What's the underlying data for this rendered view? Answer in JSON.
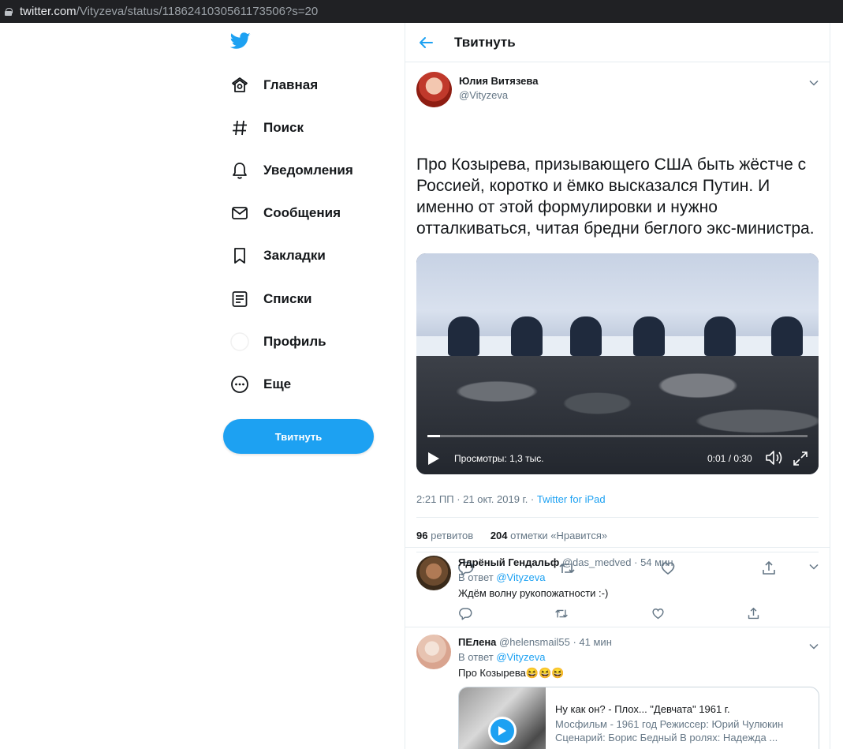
{
  "browser": {
    "url_host": "twitter.com",
    "url_path": "/Vityzeva/status/1186241030561173506?s=20"
  },
  "nav": {
    "items": [
      {
        "label": "Главная",
        "icon": "home-icon"
      },
      {
        "label": "Поиск",
        "icon": "hashtag-icon"
      },
      {
        "label": "Уведомления",
        "icon": "bell-icon"
      },
      {
        "label": "Сообщения",
        "icon": "mail-icon"
      },
      {
        "label": "Закладки",
        "icon": "bookmark-icon"
      },
      {
        "label": "Списки",
        "icon": "list-icon"
      },
      {
        "label": "Профиль",
        "icon": "profile-icon"
      },
      {
        "label": "Еще",
        "icon": "more-icon"
      }
    ],
    "tweet_button": "Твитнуть"
  },
  "header": {
    "title": "Твитнуть"
  },
  "tweet": {
    "author_name": "Юлия Витязева",
    "author_handle": "@Vityzeva",
    "text": "Про Козырева, призывающего США быть жёстче с Россией, коротко и ёмко высказался Путин. И именно от этой формулировки и нужно отталкиваться, читая бредни беглого экс-министра.",
    "video": {
      "views": "Просмотры: 1,3 тыс.",
      "time": "0:01 / 0:30",
      "progress": 0.033
    },
    "timestamp": "2:21 ПП · 21 окт. 2019 г. · ",
    "source": "Twitter for iPad",
    "retweets_count": "96",
    "retweets_label": "ретвитов",
    "likes_count": "204",
    "likes_label": "отметки «Нравится»"
  },
  "replies": [
    {
      "name": "Ядрёный Гендальф",
      "handle": "@das_medved",
      "time": "· 54 мин",
      "reply_to_label": "В ответ",
      "reply_to": "@Vityzeva",
      "text": "Ждём волну рукопожатности :-)"
    },
    {
      "name": "ПЕлена",
      "handle": "@helensmail55",
      "time": "· 41 мин",
      "reply_to_label": "В ответ",
      "reply_to": "@Vityzeva",
      "text": "Про Козырева😆😆😆",
      "card": {
        "title": "Ну как он? - Плох... \"Девчата\" 1961 г.",
        "description": "Мосфильм - 1961 год Режиссер: Юрий Чулюкин Сценарий: Борис Бедный В ролях: Надежда ..."
      }
    }
  ],
  "colors": {
    "accent": "#1da1f2",
    "text": "#14171a",
    "muted": "#657786",
    "border": "#e6ecf0"
  }
}
